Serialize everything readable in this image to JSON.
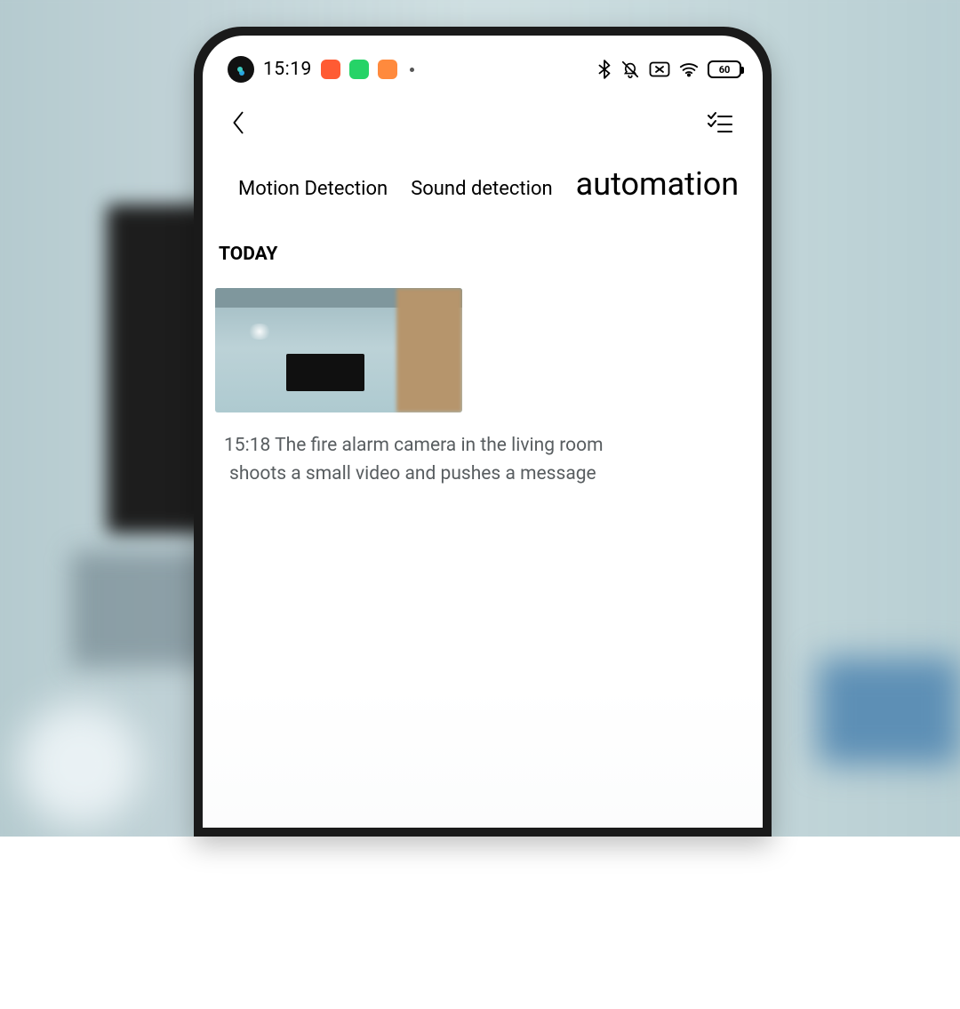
{
  "statusbar": {
    "time": "15:19",
    "battery_level": "60"
  },
  "header": {
    "back_label": "back",
    "filter_label": "filter"
  },
  "tabs": {
    "items": [
      {
        "id": "motion",
        "label": "Motion Detection",
        "active": false
      },
      {
        "id": "sound",
        "label": "Sound detection",
        "active": false
      },
      {
        "id": "automation",
        "label": "automation",
        "active": true
      }
    ]
  },
  "feed": {
    "section_label": "TODAY",
    "events": [
      {
        "time": "15:18",
        "line1": "15:18 The fire alarm camera in the living room",
        "line2": "shoots a small video and pushes a message"
      }
    ]
  }
}
